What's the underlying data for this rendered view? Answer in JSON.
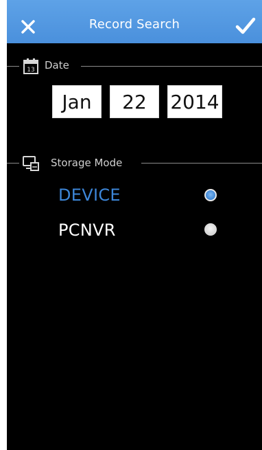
{
  "header": {
    "title": "Record Search",
    "close_icon": "close-icon",
    "confirm_icon": "checkmark-icon",
    "bar_color": "#4a90dc"
  },
  "date_section": {
    "label": "Date",
    "icon": "calendar-icon",
    "icon_day": "13",
    "month": "Jan",
    "day": "22",
    "year": "2014"
  },
  "storage_section": {
    "label": "Storage Mode",
    "icon": "storage-device-icon",
    "options": [
      {
        "label": "DEVICE",
        "selected": true,
        "color": "#3d86d8"
      },
      {
        "label": "PCNVR",
        "selected": false,
        "color": "#ffffff"
      }
    ]
  }
}
